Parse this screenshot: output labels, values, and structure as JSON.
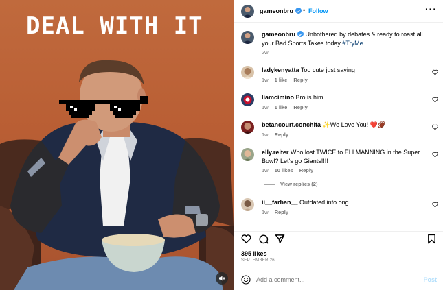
{
  "media": {
    "overlay_text": "DEAL WITH IT",
    "colors": {
      "background": "#b95e34",
      "text": "#ffffff"
    }
  },
  "header": {
    "username": "gameonbru",
    "separator": "•",
    "follow_label": "Follow",
    "more_label": "···"
  },
  "caption": {
    "username": "gameonbru",
    "text": "Unbothered by debates & ready to roast all your Bad Sports Takes today ",
    "hashtag": "#TryMe",
    "time": "2w"
  },
  "comments": [
    {
      "username": "ladykenyatta",
      "text": "Too cute just saying",
      "time": "1w",
      "likes": "1 like",
      "reply": "Reply"
    },
    {
      "username": "liamcimino",
      "text": "Bro is him",
      "time": "1w",
      "likes": "1 like",
      "reply": "Reply"
    },
    {
      "username": "betancourt.conchita",
      "text": "✨We Love You! ❤️🏈",
      "time": "1w",
      "likes": "",
      "reply": "Reply"
    },
    {
      "username": "elly.reiter",
      "text": "Who lost TWICE to ELI MANNING in the Super Bowl? Let's go Giants!!!!",
      "time": "1w",
      "likes": "10 likes",
      "reply": "Reply"
    },
    {
      "username": "ii__farhan__",
      "text": "Outdated info ong",
      "time": "1w",
      "likes": "",
      "reply": "Reply"
    }
  ],
  "view_replies": "View replies (2)",
  "likes": "395 likes",
  "date": "SEPTEMBER 26",
  "add_comment": {
    "placeholder": "Add a comment...",
    "post_label": "Post"
  },
  "icons": {
    "header_more": "more-icon",
    "like": "heart-icon",
    "comment": "comment-icon",
    "share": "send-icon",
    "save": "bookmark-icon",
    "emoji": "emoji-icon",
    "mute": "speaker-mute-icon"
  },
  "colors": {
    "link": "#0095f6",
    "hashtag": "#00376b",
    "verified": "#3897f0",
    "muted": "#737373"
  }
}
